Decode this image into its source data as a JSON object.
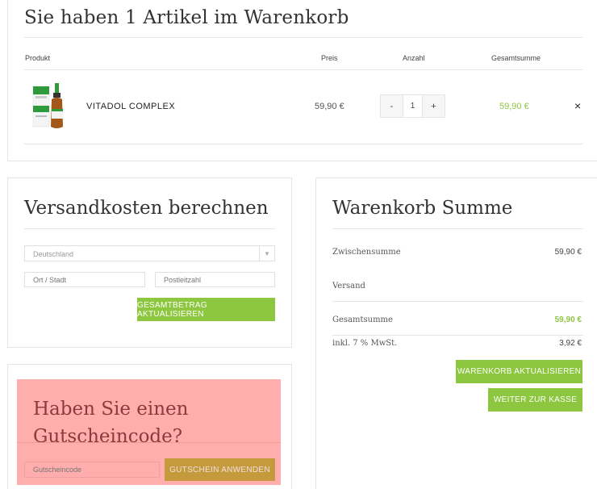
{
  "cart": {
    "title": "Sie haben 1 Artikel im Warenkorb",
    "headers": {
      "product": "Produkt",
      "price": "Preis",
      "quantity": "Anzahl",
      "total": "Gesamtsumme"
    },
    "items": [
      {
        "name": "VITADOL COMPLEX",
        "price": "59,90 €",
        "quantity": "1",
        "total": "59,90 €",
        "minus": "-",
        "plus": "+",
        "remove": "×"
      }
    ]
  },
  "shipping": {
    "title": "Versandkosten berechnen",
    "country_selected": "Deutschland",
    "city_placeholder": "Ort / Stadt",
    "zip_placeholder": "Postleitzahl",
    "update_button": "GESAMTBETRAG AKTUALISIEREN"
  },
  "totals": {
    "title": "Warenkorb Summe",
    "subtotal_label": "Zwischensumme",
    "subtotal_value": "59,90 €",
    "shipping_label": "Versand",
    "total_label": "Gesamtsumme",
    "total_value": "59,90 €",
    "tax_label": "inkl. 7 % MwSt.",
    "tax_value": "3,92 €",
    "update_cart_button": "WARENKORB AKTUALISIEREN",
    "checkout_button": "WEITER ZUR KASSE"
  },
  "coupon": {
    "title": "Haben Sie einen Gutscheincode?",
    "placeholder": "Gutscheincode",
    "apply_button": "GUTSCHEIN ANWENDEN"
  },
  "colors": {
    "accent": "#8dc63f",
    "highlight": "#ffadad",
    "coupon_button": "#c49a3d"
  }
}
